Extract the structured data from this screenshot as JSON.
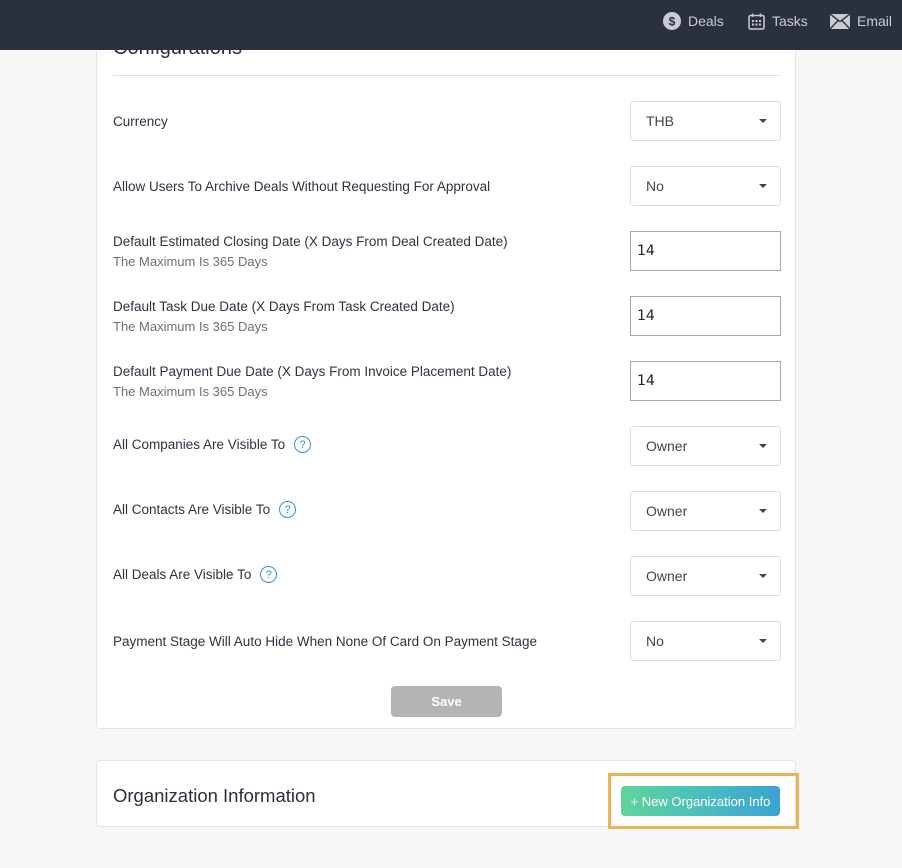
{
  "topbar": {
    "nav": [
      {
        "label": "Deals",
        "icon": "dollar-icon"
      },
      {
        "label": "Tasks",
        "icon": "calendar-icon"
      },
      {
        "label": "Email",
        "icon": "envelope-icon"
      }
    ]
  },
  "configurations": {
    "title": "Configurations",
    "rows": [
      {
        "label": "Currency",
        "type": "select",
        "value": "THB"
      },
      {
        "label": "Allow Users To Archive Deals Without Requesting For Approval",
        "type": "select",
        "value": "No"
      },
      {
        "label": "Default Estimated Closing Date (X Days From Deal Created Date)",
        "sub": "The Maximum Is 365 Days",
        "type": "number",
        "value": "14"
      },
      {
        "label": "Default Task Due Date (X Days From Task Created Date)",
        "sub": "The Maximum Is 365 Days",
        "type": "number",
        "value": "14"
      },
      {
        "label": "Default Payment Due Date (X Days From Invoice Placement Date)",
        "sub": "The Maximum Is 365 Days",
        "type": "number",
        "value": "14"
      },
      {
        "label": "All Companies Are Visible To",
        "help": true,
        "type": "select",
        "value": "Owner"
      },
      {
        "label": "All Contacts Are Visible To",
        "help": true,
        "type": "select",
        "value": "Owner"
      },
      {
        "label": "All Deals Are Visible To",
        "help": true,
        "type": "select",
        "value": "Owner"
      },
      {
        "label": "Payment Stage Will Auto Hide When None Of Card On Payment Stage",
        "type": "select",
        "value": "No"
      }
    ],
    "help_glyph": "?",
    "save_label": "Save"
  },
  "organization": {
    "title": "Organization Information",
    "new_button_label": "+ New Organization Info"
  },
  "colors": {
    "topbar_bg": "#2b303e",
    "help_blue": "#3a8fd0",
    "save_disabled": "#b4b4b4",
    "highlight": "#edb358",
    "gradient_start": "#5fd59b",
    "gradient_end": "#3ba3d3"
  }
}
